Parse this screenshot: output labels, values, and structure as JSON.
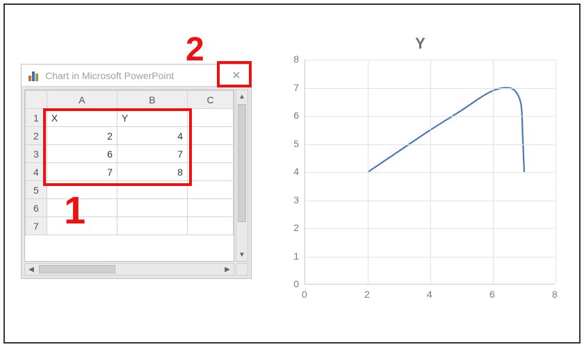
{
  "annotations": {
    "label1": "1",
    "label2": "2"
  },
  "sheet_window": {
    "title": "Chart in Microsoft PowerPoint",
    "close_glyph": "✕",
    "column_headers": [
      "A",
      "B",
      "C"
    ],
    "row_headers": [
      "1",
      "2",
      "3",
      "4",
      "5",
      "6",
      "7"
    ],
    "cells": {
      "r1": {
        "A": "X",
        "B": "Y",
        "C": ""
      },
      "r2": {
        "A": "2",
        "B": "4",
        "C": ""
      },
      "r3": {
        "A": "6",
        "B": "7",
        "C": ""
      },
      "r4": {
        "A": "7",
        "B": "8",
        "C": ""
      },
      "r5": {
        "A": "",
        "B": "",
        "C": ""
      },
      "r6": {
        "A": "",
        "B": "",
        "C": ""
      },
      "r7": {
        "A": "",
        "B": "",
        "C": ""
      }
    },
    "scroll": {
      "up": "▲",
      "down": "▼",
      "left": "◀",
      "right": "▶"
    }
  },
  "chart": {
    "title": "Y",
    "y_ticks": [
      "0",
      "1",
      "2",
      "3",
      "4",
      "5",
      "6",
      "7",
      "8"
    ],
    "x_ticks": [
      "0",
      "2",
      "4",
      "6",
      "8"
    ]
  },
  "chart_data": {
    "type": "line",
    "title": "Y",
    "xlabel": "",
    "ylabel": "",
    "xlim": [
      0,
      8
    ],
    "ylim": [
      0,
      8
    ],
    "grid": true,
    "series": [
      {
        "name": "Y",
        "x": [
          2,
          6,
          7
        ],
        "y": [
          4,
          7,
          8
        ],
        "smoothed": true,
        "note": "Plotted as a smoothed line through control points (2,4)-(6,7)-(7,8); visual curve overshoots before dropping near x≈7.",
        "curve_samples": {
          "x": [
            2.0,
            3.0,
            4.0,
            5.0,
            5.6,
            6.0,
            6.4,
            6.7,
            6.9,
            6.95,
            7.0
          ],
          "y": [
            4.0,
            4.75,
            5.5,
            6.2,
            6.65,
            6.9,
            7.0,
            6.9,
            6.4,
            5.3,
            4.0
          ]
        }
      }
    ]
  },
  "colors": {
    "line": "#4a78b8",
    "annot": "#e11b1b"
  }
}
